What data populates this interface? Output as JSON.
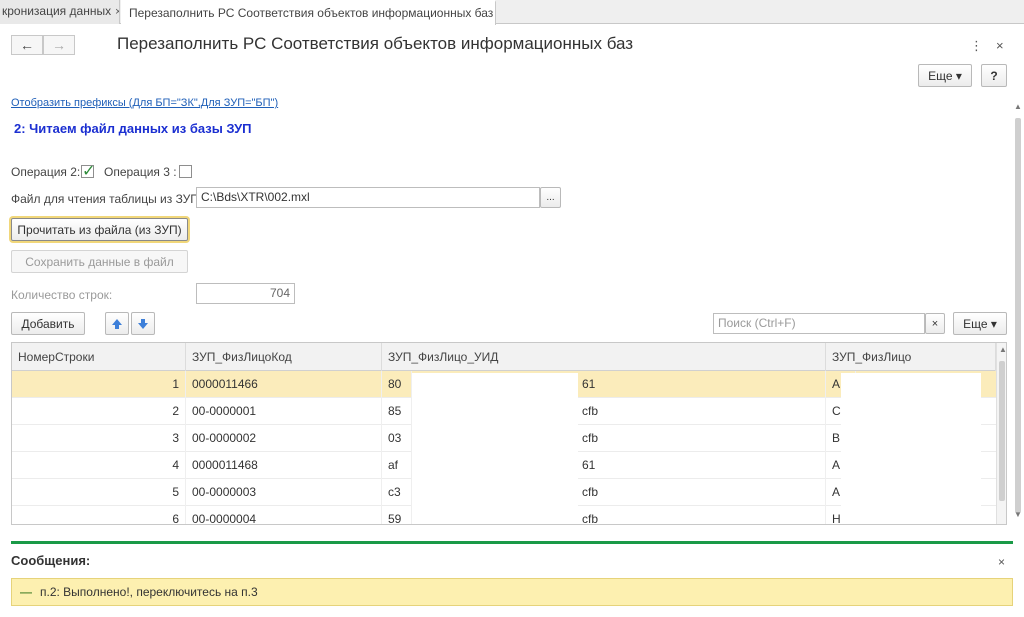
{
  "tabs": [
    {
      "label": "кронизация данных",
      "close": "×"
    },
    {
      "label": "Перезаполнить РС Соответствия объектов информационных баз",
      "close": "×"
    }
  ],
  "window": {
    "title": "Перезаполнить РС Соответствия объектов информационных баз",
    "back": "←",
    "forward": "→",
    "menu_icon": "⋮",
    "close_icon": "×",
    "more_label": "Еще ▾",
    "help_label": "?"
  },
  "form": {
    "prefix_link": "Отобразить префиксы (Для БП=\"ЗК\",Для ЗУП=\"БП\")",
    "section_title": "2: Читаем файл данных из базы ЗУП",
    "op2_label": "Операция 2:",
    "op2_checked": true,
    "op3_label": "Операция 3 :",
    "op3_checked": false,
    "file_label": "Файл для чтения таблицы из ЗУП:",
    "file_value": "C:\\Bds\\XTR\\002.mxl",
    "file_select": "...",
    "read_button": "Прочитать из файла (из ЗУП)",
    "save_button": "Сохранить данные в файл",
    "rows_label": "Количество строк:",
    "rows_value": "704"
  },
  "toolbar": {
    "add_label": "Добавить",
    "up_icon": "arrow-up-icon",
    "down_icon": "arrow-down-icon",
    "search_placeholder": "Поиск (Ctrl+F)",
    "search_clear": "×",
    "more_label": "Еще ▾"
  },
  "table": {
    "columns": [
      "НомерСтроки",
      "ЗУП_ФизЛицоКод",
      "ЗУП_ФизЛицо_УИД",
      "ЗУП_ФизЛицо"
    ],
    "rows": [
      {
        "n": "1",
        "code": "0000011466",
        "uid_a": "80",
        "uid_b": "61",
        "name": "A"
      },
      {
        "n": "2",
        "code": "00-0000001",
        "uid_a": "85",
        "uid_b": "cfb",
        "name": "C"
      },
      {
        "n": "3",
        "code": "00-0000002",
        "uid_a": "03",
        "uid_b": "cfb",
        "name": "B"
      },
      {
        "n": "4",
        "code": "0000011468",
        "uid_a": "af",
        "uid_b": "61",
        "name": "A"
      },
      {
        "n": "5",
        "code": "00-0000003",
        "uid_a": "c3",
        "uid_b": "cfb",
        "name": "A"
      },
      {
        "n": "6",
        "code": "00-0000004",
        "uid_a": "59",
        "uid_b": "cfb",
        "name": "H"
      }
    ]
  },
  "messages": {
    "title": "Сообщения:",
    "close": "×",
    "items": [
      "п.2: Выполнено!, переключитесь на п.3"
    ],
    "item_marker": "—"
  },
  "colors": {
    "accent_green": "#1a9a47",
    "link_blue": "#1f5fb8",
    "section_blue": "#1b2fd1",
    "selected_row": "#fbecbb",
    "message_bg": "#fdf0b0"
  }
}
